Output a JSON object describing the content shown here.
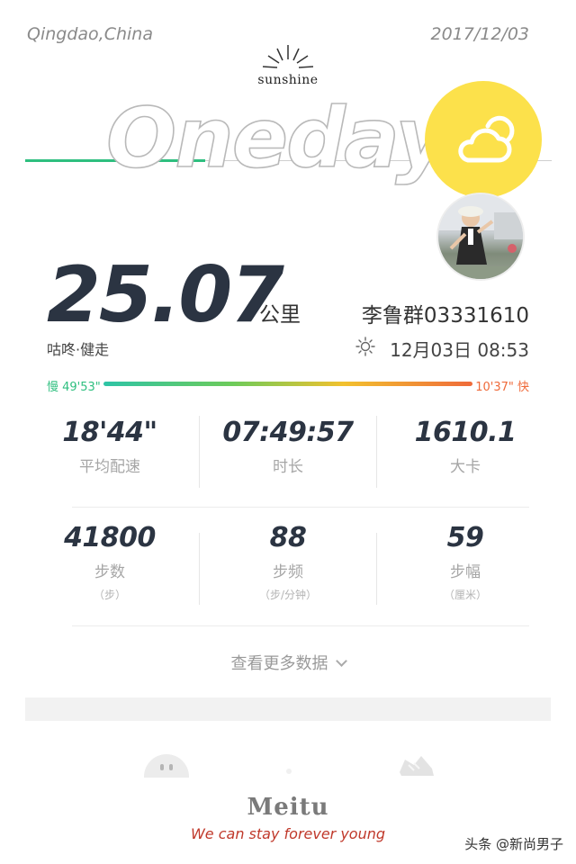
{
  "header": {
    "city": "Qingdao,China",
    "date": "2017/12/03",
    "brand": "sunshine"
  },
  "title": {
    "text": "Oneday"
  },
  "weather": {
    "icon": "cloud-sun-icon",
    "color": "#fce14b"
  },
  "run": {
    "distance": "25.07",
    "unit": "公里",
    "username": "李鲁群03331610",
    "activity": "咕咚·健走",
    "datetime": "12月03日 08:53"
  },
  "pace": {
    "slow": "慢 49'53\"",
    "fast": "10'37\" 快"
  },
  "stats_row1": [
    {
      "value": "18'44\"",
      "label": "平均配速"
    },
    {
      "value": "07:49:57",
      "label": "时长"
    },
    {
      "value": "1610.1",
      "label": "大卡"
    }
  ],
  "stats_row2": [
    {
      "value": "41800",
      "label": "步数",
      "unit": "（步）"
    },
    {
      "value": "88",
      "label": "步频",
      "unit": "（步/分钟）"
    },
    {
      "value": "59",
      "label": "步幅",
      "unit": "（厘米）"
    }
  ],
  "more": {
    "label": "查看更多数据"
  },
  "footer": {
    "meitu": "Meitu",
    "slogan": "We can stay forever young",
    "watermark": "头条 @新尚男子"
  },
  "colors": {
    "accent_green": "#2ebf7f",
    "accent_orange": "#ef6a3a",
    "text_dark": "#2b3442"
  }
}
